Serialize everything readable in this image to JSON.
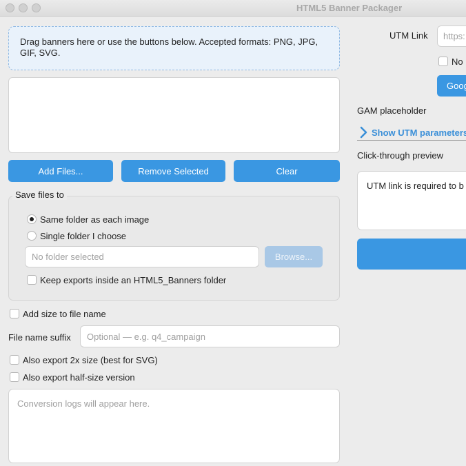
{
  "window": {
    "title": "HTML5 Banner Packager"
  },
  "dropzone": {
    "text": "Drag banners here or use the buttons below. Accepted formats: PNG, JPG, GIF, SVG."
  },
  "buttons": {
    "add_files": "Add Files...",
    "remove_selected": "Remove Selected",
    "clear": "Clear",
    "browse": "Browse...",
    "google": "Goog"
  },
  "save_group": {
    "label": "Save files to",
    "option_same": "Same folder as each image",
    "option_single": "Single folder I choose",
    "folder_placeholder": "No folder selected",
    "keep_exports": "Keep exports inside an HTML5_Banners folder"
  },
  "options": {
    "add_size": "Add size to file name",
    "suffix_label": "File name suffix",
    "suffix_placeholder": "Optional — e.g. q4_campaign",
    "export_2x": "Also export 2x size (best for SVG)",
    "export_half": "Also export half-size version"
  },
  "logs": {
    "placeholder": "Conversion logs will appear here."
  },
  "right": {
    "utm_label": "UTM Link",
    "utm_placeholder": "https:",
    "no_checkbox_label": "No",
    "gam_label": "GAM placeholder",
    "show_utm": "Show UTM parameters",
    "preview_label": "Click-through preview",
    "preview_text": "UTM link is required to b"
  },
  "colors": {
    "accent": "#3a97e2",
    "disabled": "#a9c8e6",
    "link": "#3a8fd8"
  }
}
